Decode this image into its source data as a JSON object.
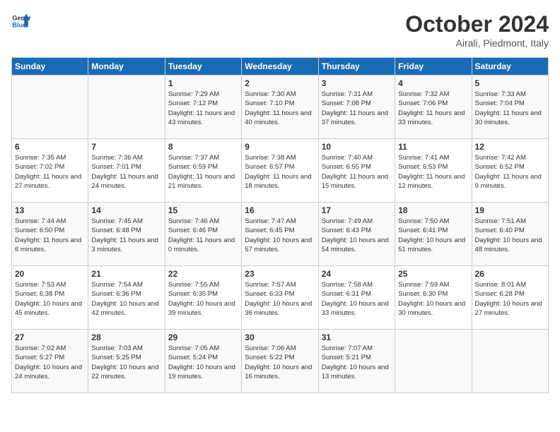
{
  "header": {
    "logo_general": "General",
    "logo_blue": "Blue",
    "month": "October 2024",
    "location": "Airali, Piedmont, Italy"
  },
  "days_of_week": [
    "Sunday",
    "Monday",
    "Tuesday",
    "Wednesday",
    "Thursday",
    "Friday",
    "Saturday"
  ],
  "weeks": [
    [
      {
        "day": "",
        "info": ""
      },
      {
        "day": "",
        "info": ""
      },
      {
        "day": "1",
        "info": "Sunrise: 7:29 AM\nSunset: 7:12 PM\nDaylight: 11 hours and 43 minutes."
      },
      {
        "day": "2",
        "info": "Sunrise: 7:30 AM\nSunset: 7:10 PM\nDaylight: 11 hours and 40 minutes."
      },
      {
        "day": "3",
        "info": "Sunrise: 7:31 AM\nSunset: 7:08 PM\nDaylight: 11 hours and 37 minutes."
      },
      {
        "day": "4",
        "info": "Sunrise: 7:32 AM\nSunset: 7:06 PM\nDaylight: 11 hours and 33 minutes."
      },
      {
        "day": "5",
        "info": "Sunrise: 7:33 AM\nSunset: 7:04 PM\nDaylight: 11 hours and 30 minutes."
      }
    ],
    [
      {
        "day": "6",
        "info": "Sunrise: 7:35 AM\nSunset: 7:02 PM\nDaylight: 11 hours and 27 minutes."
      },
      {
        "day": "7",
        "info": "Sunrise: 7:36 AM\nSunset: 7:01 PM\nDaylight: 11 hours and 24 minutes."
      },
      {
        "day": "8",
        "info": "Sunrise: 7:37 AM\nSunset: 6:59 PM\nDaylight: 11 hours and 21 minutes."
      },
      {
        "day": "9",
        "info": "Sunrise: 7:38 AM\nSunset: 6:57 PM\nDaylight: 11 hours and 18 minutes."
      },
      {
        "day": "10",
        "info": "Sunrise: 7:40 AM\nSunset: 6:55 PM\nDaylight: 11 hours and 15 minutes."
      },
      {
        "day": "11",
        "info": "Sunrise: 7:41 AM\nSunset: 6:53 PM\nDaylight: 11 hours and 12 minutes."
      },
      {
        "day": "12",
        "info": "Sunrise: 7:42 AM\nSunset: 6:52 PM\nDaylight: 11 hours and 9 minutes."
      }
    ],
    [
      {
        "day": "13",
        "info": "Sunrise: 7:44 AM\nSunset: 6:50 PM\nDaylight: 11 hours and 6 minutes."
      },
      {
        "day": "14",
        "info": "Sunrise: 7:45 AM\nSunset: 6:48 PM\nDaylight: 11 hours and 3 minutes."
      },
      {
        "day": "15",
        "info": "Sunrise: 7:46 AM\nSunset: 6:46 PM\nDaylight: 11 hours and 0 minutes."
      },
      {
        "day": "16",
        "info": "Sunrise: 7:47 AM\nSunset: 6:45 PM\nDaylight: 10 hours and 57 minutes."
      },
      {
        "day": "17",
        "info": "Sunrise: 7:49 AM\nSunset: 6:43 PM\nDaylight: 10 hours and 54 minutes."
      },
      {
        "day": "18",
        "info": "Sunrise: 7:50 AM\nSunset: 6:41 PM\nDaylight: 10 hours and 51 minutes."
      },
      {
        "day": "19",
        "info": "Sunrise: 7:51 AM\nSunset: 6:40 PM\nDaylight: 10 hours and 48 minutes."
      }
    ],
    [
      {
        "day": "20",
        "info": "Sunrise: 7:53 AM\nSunset: 6:38 PM\nDaylight: 10 hours and 45 minutes."
      },
      {
        "day": "21",
        "info": "Sunrise: 7:54 AM\nSunset: 6:36 PM\nDaylight: 10 hours and 42 minutes."
      },
      {
        "day": "22",
        "info": "Sunrise: 7:55 AM\nSunset: 6:35 PM\nDaylight: 10 hours and 39 minutes."
      },
      {
        "day": "23",
        "info": "Sunrise: 7:57 AM\nSunset: 6:33 PM\nDaylight: 10 hours and 36 minutes."
      },
      {
        "day": "24",
        "info": "Sunrise: 7:58 AM\nSunset: 6:31 PM\nDaylight: 10 hours and 33 minutes."
      },
      {
        "day": "25",
        "info": "Sunrise: 7:59 AM\nSunset: 6:30 PM\nDaylight: 10 hours and 30 minutes."
      },
      {
        "day": "26",
        "info": "Sunrise: 8:01 AM\nSunset: 6:28 PM\nDaylight: 10 hours and 27 minutes."
      }
    ],
    [
      {
        "day": "27",
        "info": "Sunrise: 7:02 AM\nSunset: 5:27 PM\nDaylight: 10 hours and 24 minutes."
      },
      {
        "day": "28",
        "info": "Sunrise: 7:03 AM\nSunset: 5:25 PM\nDaylight: 10 hours and 22 minutes."
      },
      {
        "day": "29",
        "info": "Sunrise: 7:05 AM\nSunset: 5:24 PM\nDaylight: 10 hours and 19 minutes."
      },
      {
        "day": "30",
        "info": "Sunrise: 7:06 AM\nSunset: 5:22 PM\nDaylight: 10 hours and 16 minutes."
      },
      {
        "day": "31",
        "info": "Sunrise: 7:07 AM\nSunset: 5:21 PM\nDaylight: 10 hours and 13 minutes."
      },
      {
        "day": "",
        "info": ""
      },
      {
        "day": "",
        "info": ""
      }
    ]
  ]
}
